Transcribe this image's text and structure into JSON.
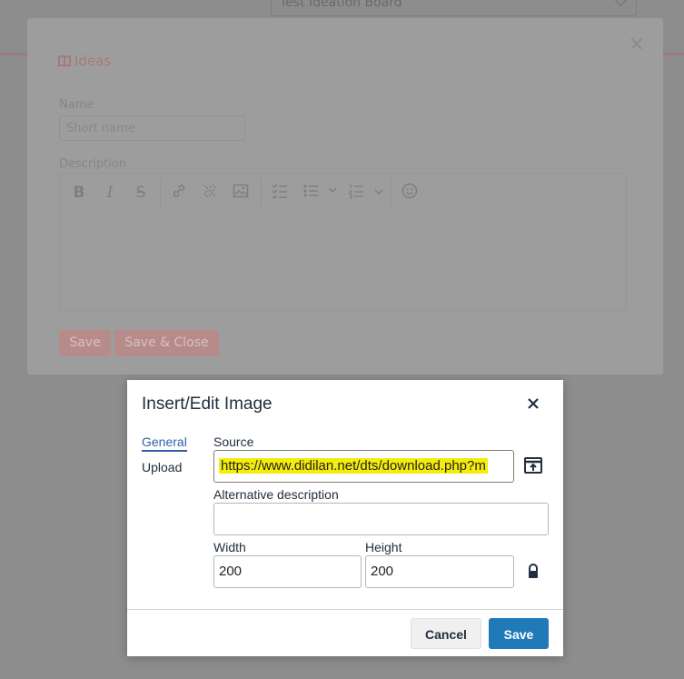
{
  "background": {
    "board_select": "Test Ideation Board"
  },
  "modal": {
    "close_glyph": "×",
    "title": "Ideas",
    "name_label": "Name",
    "name_placeholder": "Short name",
    "description_label": "Description",
    "save_label": "Save",
    "save_close_label": "Save & Close",
    "toolbar_icons": [
      "bold-icon",
      "italic-icon",
      "strikethrough-icon",
      "link-icon",
      "unlink-icon",
      "image-icon",
      "checklist-icon",
      "bullet-list-icon",
      "numbered-list-icon",
      "emoji-icon"
    ]
  },
  "dialog": {
    "title": "Insert/Edit Image",
    "tabs": [
      {
        "label": "General",
        "active": true
      },
      {
        "label": "Upload",
        "active": false
      }
    ],
    "source_label": "Source",
    "source_value": "https://www.didilan.net/dts/download.php?m",
    "alt_label": "Alternative description",
    "alt_value": "",
    "width_label": "Width",
    "width_value": "200",
    "height_label": "Height",
    "height_value": "200",
    "cancel_label": "Cancel",
    "save_label": "Save"
  },
  "colors": {
    "accent": "#207ab7",
    "tab_active": "#335dab",
    "highlight": "#f5ec0c"
  }
}
